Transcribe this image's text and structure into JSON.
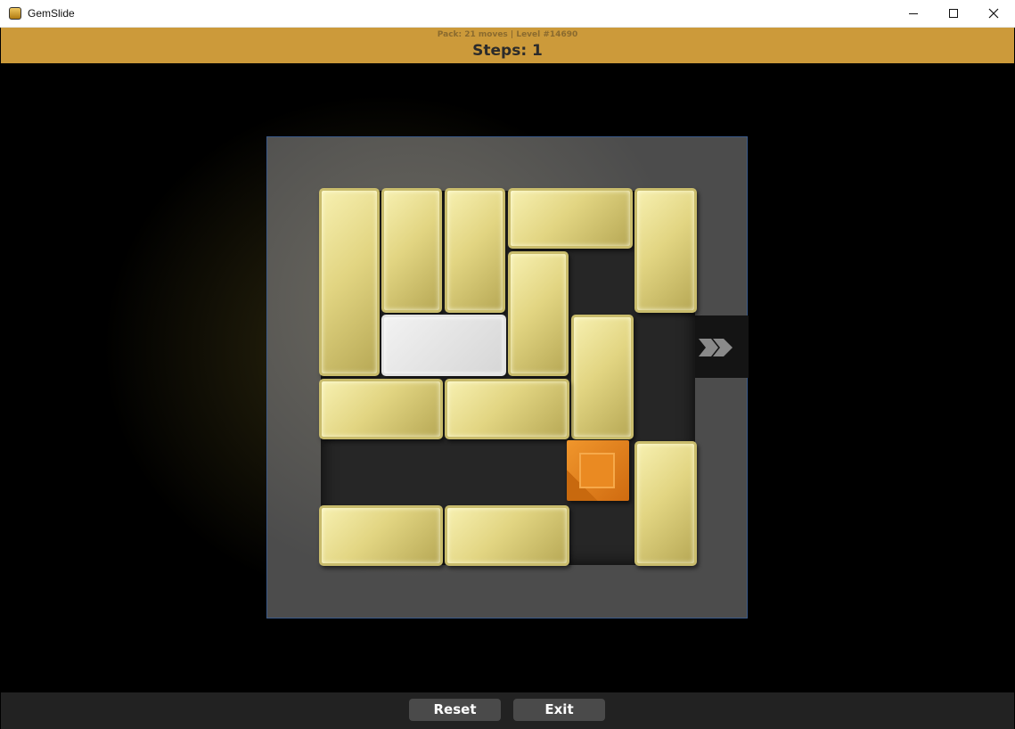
{
  "window": {
    "title": "GemSlide",
    "icon": "gemslide-app-icon"
  },
  "header": {
    "pack_info": "Pack: 21 moves | Level #14690",
    "steps": "Steps: 1"
  },
  "board": {
    "exit_icon": "exit-arrow-icon",
    "blocks": [
      {
        "id": "gold-1",
        "kind": "gold"
      },
      {
        "id": "gold-2",
        "kind": "gold"
      },
      {
        "id": "gold-3",
        "kind": "gold"
      },
      {
        "id": "gold-4",
        "kind": "gold"
      },
      {
        "id": "gold-5",
        "kind": "gold"
      },
      {
        "id": "stone-1",
        "kind": "stone"
      },
      {
        "id": "gold-6",
        "kind": "gold"
      },
      {
        "id": "gold-7",
        "kind": "gold"
      },
      {
        "id": "gold-8",
        "kind": "gold"
      },
      {
        "id": "gold-9",
        "kind": "gold"
      },
      {
        "id": "gem",
        "kind": "gem"
      },
      {
        "id": "gold-10",
        "kind": "gold"
      },
      {
        "id": "gold-11",
        "kind": "gold"
      },
      {
        "id": "gold-12",
        "kind": "gold"
      }
    ]
  },
  "footer": {
    "reset_label": "Reset",
    "exit_label": "Exit"
  },
  "colors": {
    "header": "#cc9a3a",
    "gold": "#e2d582",
    "gem": "#e8892a",
    "stone": "#e0e0e0"
  }
}
